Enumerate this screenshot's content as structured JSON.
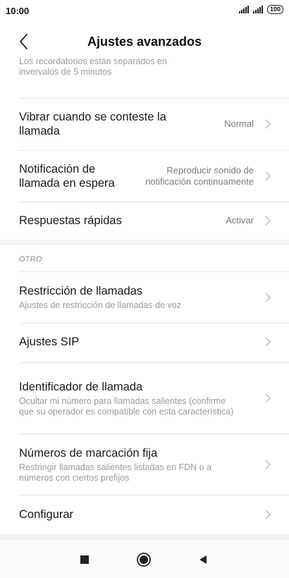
{
  "status_bar": {
    "time": "10:00",
    "battery": "100"
  },
  "header": {
    "title": "Ajustes avanzados",
    "back_icon": "chevron-left-icon"
  },
  "clipped_text": "Los recordatorios están separados en invervalos de 5 minutos",
  "settings": {
    "vibrate": {
      "title": "Vibrar cuando se conteste la llamada",
      "value": "Normal"
    },
    "call_waiting": {
      "title": "Notificación de llamada en espera",
      "value": "Reproducir sonido de notificación continuamente"
    },
    "quick_replies": {
      "title": "Respuestas rápidas",
      "value": "Activar"
    }
  },
  "other_section": {
    "header": "OTRO",
    "items": [
      {
        "title": "Restricción de llamadas",
        "subtitle": "Ajustes de restricción de llamadas de voz"
      },
      {
        "title": "Ajustes SIP",
        "subtitle": ""
      },
      {
        "title": "Identificador de llamada",
        "subtitle": "Ocultar mi número para llamadas salientes (confirme que su operador es compatible con esta característica)"
      },
      {
        "title": "Números de marcación fija",
        "subtitle": "Restringir llamadas salientes listadas en FDN o a números con ciertos prefijos"
      },
      {
        "title": "Configurar",
        "subtitle": ""
      }
    ]
  },
  "nav_bar": {
    "icons": [
      "recents-square-icon",
      "home-circle-icon",
      "back-triangle-icon"
    ]
  },
  "colors": {
    "text_primary": "#1a1a1a",
    "text_secondary": "#9a9a9a",
    "divider": "#e6e6e6",
    "section_gap": "#f2f2f2"
  }
}
